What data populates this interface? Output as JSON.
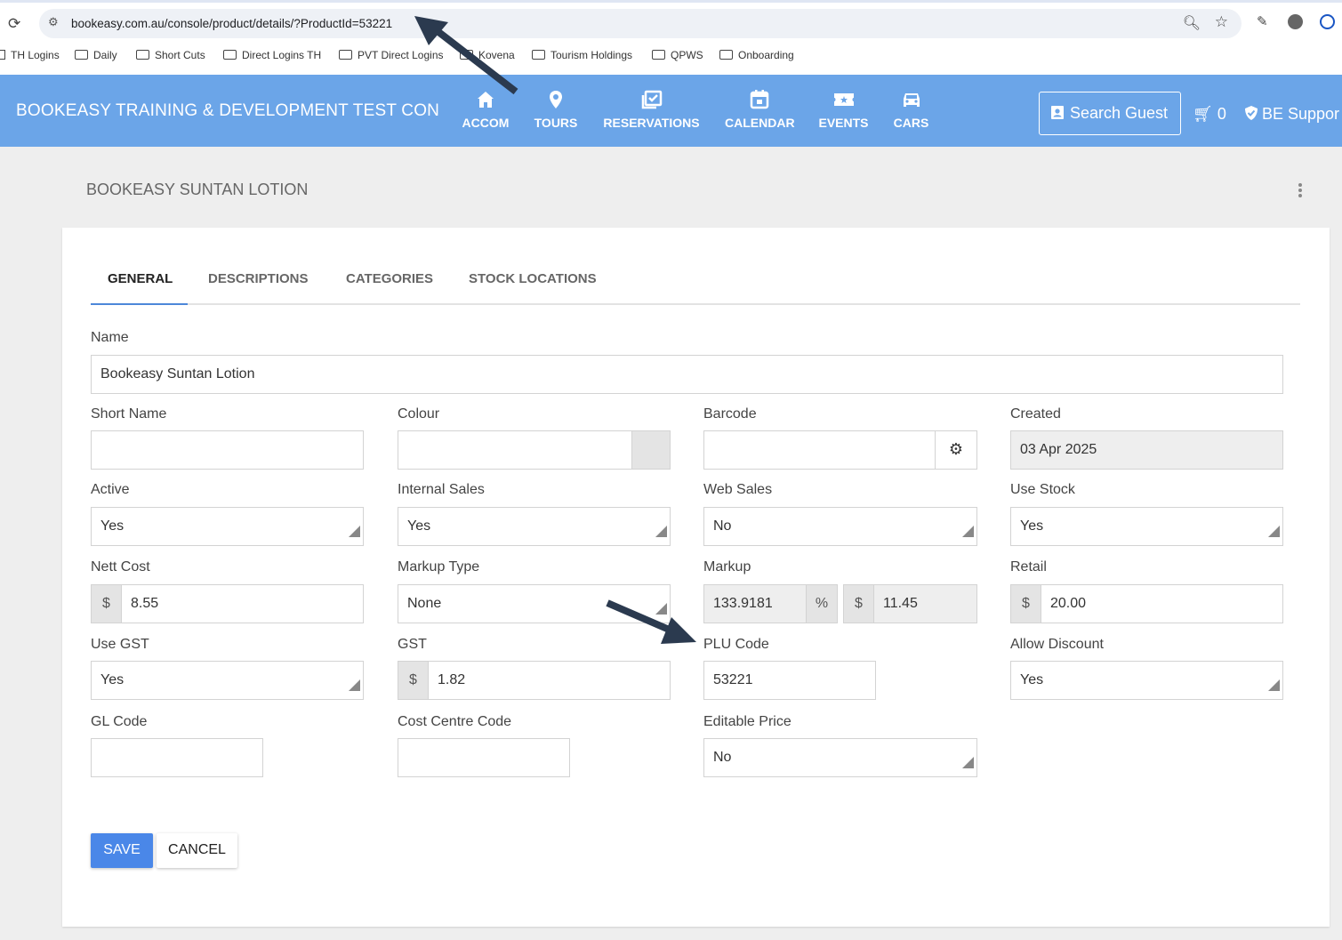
{
  "browser": {
    "url": "bookeasy.com.au/console/product/details/?ProductId=53221",
    "bookmarks": [
      "TH Logins",
      "Daily",
      "Short Cuts",
      "Direct Logins TH",
      "PVT Direct Logins",
      "Kovena",
      "Tourism Holdings",
      "QPWS",
      "Onboarding"
    ]
  },
  "app": {
    "brand": "BOOKEASY TRAINING & DEVELOPMENT TEST CON",
    "nav": [
      {
        "label": "ACCOM",
        "icon": "home-icon"
      },
      {
        "label": "TOURS",
        "icon": "map-pin-icon"
      },
      {
        "label": "RESERVATIONS",
        "icon": "reservations-icon"
      },
      {
        "label": "CALENDAR",
        "icon": "calendar-icon"
      },
      {
        "label": "EVENTS",
        "icon": "ticket-icon"
      },
      {
        "label": "CARS",
        "icon": "car-icon"
      }
    ],
    "search_guest": "Search Guest",
    "cart_count": "0",
    "support": "BE Suppor"
  },
  "page": {
    "title": "BOOKEASY SUNTAN LOTION",
    "tabs": [
      "GENERAL",
      "DESCRIPTIONS",
      "CATEGORIES",
      "STOCK LOCATIONS"
    ],
    "active_tab": "GENERAL"
  },
  "form": {
    "name": {
      "label": "Name",
      "value": "Bookeasy Suntan Lotion"
    },
    "short_name": {
      "label": "Short Name",
      "value": ""
    },
    "colour": {
      "label": "Colour",
      "value": ""
    },
    "barcode": {
      "label": "Barcode",
      "value": ""
    },
    "created": {
      "label": "Created",
      "value": "03 Apr 2025"
    },
    "active": {
      "label": "Active",
      "value": "Yes"
    },
    "internal_sales": {
      "label": "Internal Sales",
      "value": "Yes"
    },
    "web_sales": {
      "label": "Web Sales",
      "value": "No"
    },
    "use_stock": {
      "label": "Use Stock",
      "value": "Yes"
    },
    "nett_cost": {
      "label": "Nett Cost",
      "prefix": "$",
      "value": "8.55"
    },
    "markup_type": {
      "label": "Markup Type",
      "value": "None"
    },
    "markup": {
      "label": "Markup",
      "value": "133.9181",
      "suffix": "%",
      "prefix2": "$",
      "value2": "11.45"
    },
    "retail": {
      "label": "Retail",
      "prefix": "$",
      "value": "20.00"
    },
    "use_gst": {
      "label": "Use GST",
      "value": "Yes"
    },
    "gst": {
      "label": "GST",
      "prefix": "$",
      "value": "1.82"
    },
    "plu_code": {
      "label": "PLU Code",
      "value": "53221"
    },
    "allow_discount": {
      "label": "Allow Discount",
      "value": "Yes"
    },
    "gl_code": {
      "label": "GL Code",
      "value": ""
    },
    "cost_centre_code": {
      "label": "Cost Centre Code",
      "value": ""
    },
    "editable_price": {
      "label": "Editable Price",
      "value": "No"
    }
  },
  "actions": {
    "save": "SAVE",
    "cancel": "CANCEL"
  },
  "colors": {
    "appbar": "#6ba5e8",
    "primary_button": "#4a87e8",
    "annotation_arrow": "#2b3a4f"
  }
}
